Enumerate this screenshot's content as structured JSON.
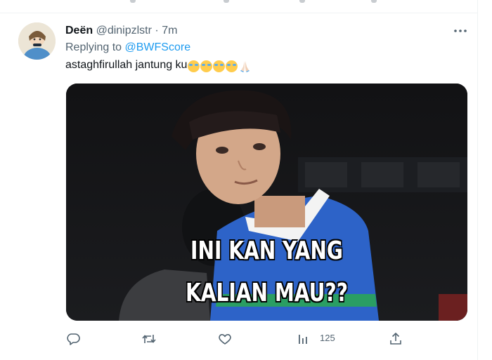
{
  "tweet": {
    "author_name": "Deën",
    "author_handle": "@dinipzlstr",
    "separator": "·",
    "time": "7m",
    "replying_prefix": "Replying to",
    "replying_to": "@BWFScore",
    "text": "astaghfirullah jantung ku",
    "emojis": [
      "loudly-crying-face",
      "loudly-crying-face",
      "loudly-crying-face",
      "loudly-crying-face",
      "folded-hands"
    ]
  },
  "media": {
    "caption_line1": "INI KAN YANG",
    "caption_line2": "KALIAN MAU??"
  },
  "actions": {
    "reply_icon": "reply-icon",
    "retweet_icon": "retweet-icon",
    "like_icon": "heart-icon",
    "views_icon": "analytics-icon",
    "views_count": "125",
    "share_icon": "share-icon"
  },
  "colors": {
    "accent": "#1d9bf0",
    "secondary_text": "#536471",
    "divider": "#eff3f4"
  }
}
